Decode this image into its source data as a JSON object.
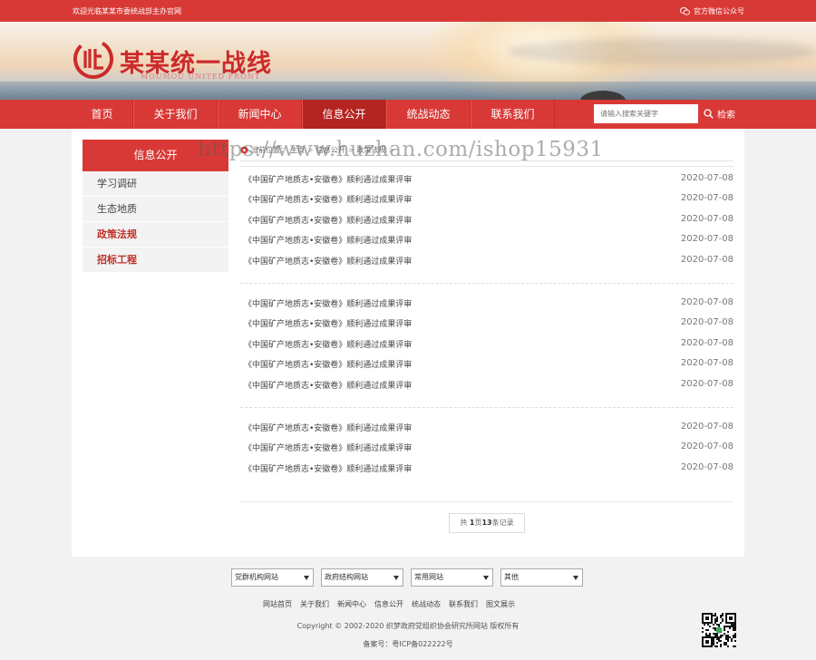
{
  "topbar": {
    "welcome": "欢迎光临某某市委统战部主办官网",
    "wechat": "官方微信公众号"
  },
  "header": {
    "title": "某某统一战线",
    "subtitle": "MOUMOU UNITED FRONT",
    "brand_color": "#d93936"
  },
  "nav": {
    "items": [
      {
        "label": "首页"
      },
      {
        "label": "关于我们"
      },
      {
        "label": "新闻中心"
      },
      {
        "label": "信息公开"
      },
      {
        "label": "统战动态"
      },
      {
        "label": "联系我们"
      }
    ],
    "active_index": 3,
    "search_placeholder": "请输入搜索关键字",
    "search_label": "检索"
  },
  "sidebar": {
    "title": "信息公开",
    "items": [
      {
        "label": "学习调研"
      },
      {
        "label": "生态地质"
      },
      {
        "label": "政策法规"
      },
      {
        "label": "招标工程"
      }
    ]
  },
  "breadcrumb": {
    "prefix": "当前位置：",
    "items": [
      "主页",
      "信息公开",
      "政策法规"
    ],
    "sep": ">"
  },
  "articles": [
    {
      "title": "《中国矿产地质志•安徽卷》顺利通过成果评审",
      "date": "2020-07-08"
    },
    {
      "title": "《中国矿产地质志•安徽卷》顺利通过成果评审",
      "date": "2020-07-08"
    },
    {
      "title": "《中国矿产地质志•安徽卷》顺利通过成果评审",
      "date": "2020-07-08"
    },
    {
      "title": "《中国矿产地质志•安徽卷》顺利通过成果评审",
      "date": "2020-07-08"
    },
    {
      "title": "《中国矿产地质志•安徽卷》顺利通过成果评审",
      "date": "2020-07-08"
    },
    {
      "title": "《中国矿产地质志•安徽卷》顺利通过成果评审",
      "date": "2020-07-08"
    },
    {
      "title": "《中国矿产地质志•安徽卷》顺利通过成果评审",
      "date": "2020-07-08"
    },
    {
      "title": "《中国矿产地质志•安徽卷》顺利通过成果评审",
      "date": "2020-07-08"
    },
    {
      "title": "《中国矿产地质志•安徽卷》顺利通过成果评审",
      "date": "2020-07-08"
    },
    {
      "title": "《中国矿产地质志•安徽卷》顺利通过成果评审",
      "date": "2020-07-08"
    },
    {
      "title": "《中国矿产地质志•安徽卷》顺利通过成果评审",
      "date": "2020-07-08"
    },
    {
      "title": "《中国矿产地质志•安徽卷》顺利通过成果评审",
      "date": "2020-07-08"
    },
    {
      "title": "《中国矿产地质志•安徽卷》顺利通过成果评审",
      "date": "2020-07-08"
    }
  ],
  "pager": {
    "pre": "共",
    "pages": "1",
    "mid": "页",
    "records": "13",
    "post": "条记录"
  },
  "footer": {
    "selects": [
      "党群机构网站",
      "政府结构网站",
      "常用网站",
      "其他"
    ],
    "links": [
      "网站首页",
      "关于我们",
      "新闻中心",
      "信息公开",
      "统战动态",
      "联系我们",
      "图文展示"
    ],
    "copyright": "Copyright © 2002-2020 织梦政府党组织协会研究所网站 版权所有",
    "icp": "备案号：粤ICP备022222号"
  },
  "watermark": "https://www.huzhan.com/ishop15931"
}
